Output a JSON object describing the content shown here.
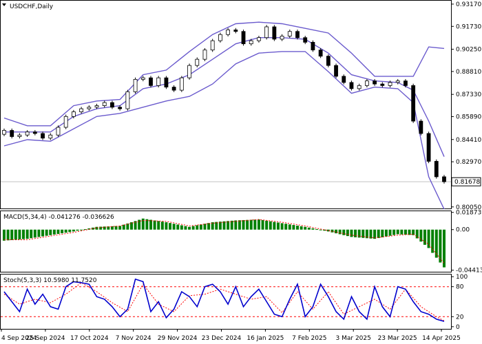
{
  "chart_data": {
    "type": "candlestick",
    "instrument": "USDCHF",
    "timeframe": "Daily",
    "title": "USDCHF,Daily",
    "current_price": "0.81678",
    "price_ticks": [
      "0.93170",
      "0.91730",
      "0.90250",
      "0.88810",
      "0.87330",
      "0.85890",
      "0.84410",
      "0.82970",
      "0.80050"
    ],
    "price_range": [
      0.7995,
      0.9339
    ],
    "date_labels": [
      "4 Sep 2024",
      "25 Sep 2024",
      "17 Oct 2024",
      "7 Nov 2024",
      "29 Nov 2024",
      "23 Dec 2024",
      "16 Jan 2025",
      "7 Feb 2025",
      "3 Mar 2025",
      "23 Mar 2025",
      "14 Apr 2025"
    ],
    "price_series": {
      "candles": [
        {
          "t": 0,
          "o": 0.8475,
          "c": 0.85
        },
        {
          "t": 2,
          "o": 0.85,
          "c": 0.846
        },
        {
          "t": 4,
          "o": 0.846,
          "c": 0.847
        },
        {
          "t": 6,
          "o": 0.847,
          "c": 0.849
        },
        {
          "t": 8,
          "o": 0.849,
          "c": 0.848
        },
        {
          "t": 10,
          "o": 0.848,
          "c": 0.845
        },
        {
          "t": 12,
          "o": 0.845,
          "c": 0.847
        },
        {
          "t": 14,
          "o": 0.847,
          "c": 0.852
        },
        {
          "t": 16,
          "o": 0.852,
          "c": 0.859
        },
        {
          "t": 18,
          "o": 0.859,
          "c": 0.862
        },
        {
          "t": 20,
          "o": 0.862,
          "c": 0.864
        },
        {
          "t": 22,
          "o": 0.864,
          "c": 0.865
        },
        {
          "t": 24,
          "o": 0.865,
          "c": 0.866
        },
        {
          "t": 26,
          "o": 0.866,
          "c": 0.868
        },
        {
          "t": 28,
          "o": 0.868,
          "c": 0.865
        },
        {
          "t": 30,
          "o": 0.865,
          "c": 0.864
        },
        {
          "t": 32,
          "o": 0.864,
          "c": 0.875
        },
        {
          "t": 34,
          "o": 0.875,
          "c": 0.883
        },
        {
          "t": 36,
          "o": 0.883,
          "c": 0.884
        },
        {
          "t": 38,
          "o": 0.884,
          "c": 0.879
        },
        {
          "t": 40,
          "o": 0.879,
          "c": 0.884
        },
        {
          "t": 42,
          "o": 0.884,
          "c": 0.878
        },
        {
          "t": 44,
          "o": 0.878,
          "c": 0.876
        },
        {
          "t": 46,
          "o": 0.876,
          "c": 0.884
        },
        {
          "t": 48,
          "o": 0.884,
          "c": 0.892
        },
        {
          "t": 50,
          "o": 0.892,
          "c": 0.896
        },
        {
          "t": 52,
          "o": 0.896,
          "c": 0.902
        },
        {
          "t": 54,
          "o": 0.902,
          "c": 0.908
        },
        {
          "t": 56,
          "o": 0.908,
          "c": 0.912
        },
        {
          "t": 58,
          "o": 0.912,
          "c": 0.915
        },
        {
          "t": 60,
          "o": 0.915,
          "c": 0.914
        },
        {
          "t": 62,
          "o": 0.914,
          "c": 0.906
        },
        {
          "t": 64,
          "o": 0.906,
          "c": 0.908
        },
        {
          "t": 66,
          "o": 0.908,
          "c": 0.91
        },
        {
          "t": 68,
          "o": 0.91,
          "c": 0.917
        },
        {
          "t": 70,
          "o": 0.917,
          "c": 0.909
        },
        {
          "t": 72,
          "o": 0.909,
          "c": 0.911
        },
        {
          "t": 74,
          "o": 0.911,
          "c": 0.914
        },
        {
          "t": 76,
          "o": 0.914,
          "c": 0.91
        },
        {
          "t": 78,
          "o": 0.91,
          "c": 0.907
        },
        {
          "t": 80,
          "o": 0.907,
          "c": 0.902
        },
        {
          "t": 82,
          "o": 0.902,
          "c": 0.898
        },
        {
          "t": 84,
          "o": 0.898,
          "c": 0.892
        },
        {
          "t": 86,
          "o": 0.892,
          "c": 0.885
        },
        {
          "t": 88,
          "o": 0.885,
          "c": 0.881
        },
        {
          "t": 90,
          "o": 0.881,
          "c": 0.877
        },
        {
          "t": 92,
          "o": 0.877,
          "c": 0.879
        },
        {
          "t": 94,
          "o": 0.879,
          "c": 0.882
        },
        {
          "t": 96,
          "o": 0.882,
          "c": 0.88
        },
        {
          "t": 98,
          "o": 0.88,
          "c": 0.879
        },
        {
          "t": 100,
          "o": 0.879,
          "c": 0.881
        },
        {
          "t": 102,
          "o": 0.881,
          "c": 0.882
        },
        {
          "t": 104,
          "o": 0.882,
          "c": 0.879
        },
        {
          "t": 106,
          "o": 0.879,
          "c": 0.856
        },
        {
          "t": 108,
          "o": 0.856,
          "c": 0.848
        },
        {
          "t": 110,
          "o": 0.848,
          "c": 0.83
        },
        {
          "t": 112,
          "o": 0.83,
          "c": 0.82
        },
        {
          "t": 114,
          "o": 0.82,
          "c": 0.8168
        }
      ],
      "bollinger_upper": [
        {
          "t": 0,
          "v": 0.858
        },
        {
          "t": 6,
          "v": 0.853
        },
        {
          "t": 12,
          "v": 0.853
        },
        {
          "t": 18,
          "v": 0.866
        },
        {
          "t": 24,
          "v": 0.869
        },
        {
          "t": 30,
          "v": 0.87
        },
        {
          "t": 36,
          "v": 0.886
        },
        {
          "t": 42,
          "v": 0.889
        },
        {
          "t": 48,
          "v": 0.901
        },
        {
          "t": 54,
          "v": 0.912
        },
        {
          "t": 60,
          "v": 0.919
        },
        {
          "t": 66,
          "v": 0.92
        },
        {
          "t": 72,
          "v": 0.919
        },
        {
          "t": 78,
          "v": 0.916
        },
        {
          "t": 84,
          "v": 0.913
        },
        {
          "t": 90,
          "v": 0.9
        },
        {
          "t": 96,
          "v": 0.885
        },
        {
          "t": 102,
          "v": 0.885
        },
        {
          "t": 106,
          "v": 0.885
        },
        {
          "t": 110,
          "v": 0.904
        },
        {
          "t": 114,
          "v": 0.903
        }
      ],
      "bollinger_middle": [
        {
          "t": 0,
          "v": 0.849
        },
        {
          "t": 6,
          "v": 0.849
        },
        {
          "t": 12,
          "v": 0.849
        },
        {
          "t": 18,
          "v": 0.859
        },
        {
          "t": 24,
          "v": 0.864
        },
        {
          "t": 30,
          "v": 0.866
        },
        {
          "t": 36,
          "v": 0.877
        },
        {
          "t": 42,
          "v": 0.88
        },
        {
          "t": 48,
          "v": 0.886
        },
        {
          "t": 54,
          "v": 0.896
        },
        {
          "t": 60,
          "v": 0.906
        },
        {
          "t": 66,
          "v": 0.91
        },
        {
          "t": 72,
          "v": 0.91
        },
        {
          "t": 78,
          "v": 0.909
        },
        {
          "t": 84,
          "v": 0.9
        },
        {
          "t": 90,
          "v": 0.886
        },
        {
          "t": 96,
          "v": 0.882
        },
        {
          "t": 102,
          "v": 0.881
        },
        {
          "t": 106,
          "v": 0.876
        },
        {
          "t": 110,
          "v": 0.856
        },
        {
          "t": 114,
          "v": 0.833
        }
      ],
      "bollinger_lower": [
        {
          "t": 0,
          "v": 0.84
        },
        {
          "t": 6,
          "v": 0.844
        },
        {
          "t": 12,
          "v": 0.843
        },
        {
          "t": 18,
          "v": 0.851
        },
        {
          "t": 24,
          "v": 0.859
        },
        {
          "t": 30,
          "v": 0.861
        },
        {
          "t": 36,
          "v": 0.865
        },
        {
          "t": 42,
          "v": 0.869
        },
        {
          "t": 48,
          "v": 0.872
        },
        {
          "t": 54,
          "v": 0.88
        },
        {
          "t": 60,
          "v": 0.893
        },
        {
          "t": 66,
          "v": 0.9
        },
        {
          "t": 72,
          "v": 0.901
        },
        {
          "t": 78,
          "v": 0.901
        },
        {
          "t": 84,
          "v": 0.888
        },
        {
          "t": 90,
          "v": 0.874
        },
        {
          "t": 96,
          "v": 0.878
        },
        {
          "t": 102,
          "v": 0.877
        },
        {
          "t": 106,
          "v": 0.868
        },
        {
          "t": 110,
          "v": 0.82
        },
        {
          "t": 114,
          "v": 0.799
        }
      ]
    },
    "macd": {
      "label": "MACD(5,34,4) -0.041276 -0.036626",
      "ticks": [
        "0.018739",
        "0.00",
        "-0.044134"
      ],
      "range": [
        -0.0458,
        0.02
      ],
      "histogram_points": [
        {
          "t": 0,
          "v": -0.012
        },
        {
          "t": 6,
          "v": -0.01
        },
        {
          "t": 12,
          "v": -0.006
        },
        {
          "t": 18,
          "v": -0.002
        },
        {
          "t": 24,
          "v": 0.003
        },
        {
          "t": 30,
          "v": 0.004
        },
        {
          "t": 36,
          "v": 0.012
        },
        {
          "t": 42,
          "v": 0.008
        },
        {
          "t": 48,
          "v": 0.003
        },
        {
          "t": 54,
          "v": 0.008
        },
        {
          "t": 60,
          "v": 0.01
        },
        {
          "t": 66,
          "v": 0.011
        },
        {
          "t": 72,
          "v": 0.007
        },
        {
          "t": 78,
          "v": 0.003
        },
        {
          "t": 84,
          "v": -0.002
        },
        {
          "t": 90,
          "v": -0.008
        },
        {
          "t": 96,
          "v": -0.01
        },
        {
          "t": 102,
          "v": -0.005
        },
        {
          "t": 106,
          "v": -0.006
        },
        {
          "t": 110,
          "v": -0.02
        },
        {
          "t": 114,
          "v": -0.041
        }
      ],
      "signal_points": [
        {
          "t": 0,
          "v": -0.011
        },
        {
          "t": 6,
          "v": -0.011
        },
        {
          "t": 12,
          "v": -0.007
        },
        {
          "t": 18,
          "v": -0.003
        },
        {
          "t": 24,
          "v": 0.002
        },
        {
          "t": 30,
          "v": 0.004
        },
        {
          "t": 36,
          "v": 0.01
        },
        {
          "t": 42,
          "v": 0.009
        },
        {
          "t": 48,
          "v": 0.004
        },
        {
          "t": 54,
          "v": 0.007
        },
        {
          "t": 60,
          "v": 0.009
        },
        {
          "t": 66,
          "v": 0.011
        },
        {
          "t": 72,
          "v": 0.008
        },
        {
          "t": 78,
          "v": 0.004
        },
        {
          "t": 84,
          "v": -0.001
        },
        {
          "t": 90,
          "v": -0.006
        },
        {
          "t": 96,
          "v": -0.009
        },
        {
          "t": 102,
          "v": -0.006
        },
        {
          "t": 106,
          "v": -0.005
        },
        {
          "t": 110,
          "v": -0.016
        },
        {
          "t": 114,
          "v": -0.0366
        }
      ]
    },
    "stochastic": {
      "label": "Stoch(5,3,3) 10.5980 11.7520",
      "ticks": [
        "100",
        "80",
        "20",
        "0"
      ],
      "levels": [
        80,
        20
      ],
      "main_points": [
        {
          "t": 0,
          "v": 70
        },
        {
          "t": 2,
          "v": 50
        },
        {
          "t": 4,
          "v": 30
        },
        {
          "t": 6,
          "v": 75
        },
        {
          "t": 8,
          "v": 45
        },
        {
          "t": 10,
          "v": 65
        },
        {
          "t": 12,
          "v": 40
        },
        {
          "t": 14,
          "v": 35
        },
        {
          "t": 16,
          "v": 80
        },
        {
          "t": 18,
          "v": 90
        },
        {
          "t": 20,
          "v": 88
        },
        {
          "t": 22,
          "v": 85
        },
        {
          "t": 24,
          "v": 60
        },
        {
          "t": 26,
          "v": 55
        },
        {
          "t": 28,
          "v": 40
        },
        {
          "t": 30,
          "v": 20
        },
        {
          "t": 32,
          "v": 35
        },
        {
          "t": 34,
          "v": 95
        },
        {
          "t": 36,
          "v": 90
        },
        {
          "t": 38,
          "v": 30
        },
        {
          "t": 40,
          "v": 50
        },
        {
          "t": 42,
          "v": 18
        },
        {
          "t": 44,
          "v": 35
        },
        {
          "t": 46,
          "v": 70
        },
        {
          "t": 48,
          "v": 60
        },
        {
          "t": 50,
          "v": 40
        },
        {
          "t": 52,
          "v": 80
        },
        {
          "t": 54,
          "v": 85
        },
        {
          "t": 56,
          "v": 70
        },
        {
          "t": 58,
          "v": 45
        },
        {
          "t": 60,
          "v": 80
        },
        {
          "t": 62,
          "v": 40
        },
        {
          "t": 64,
          "v": 60
        },
        {
          "t": 66,
          "v": 75
        },
        {
          "t": 68,
          "v": 50
        },
        {
          "t": 70,
          "v": 25
        },
        {
          "t": 72,
          "v": 20
        },
        {
          "t": 74,
          "v": 55
        },
        {
          "t": 76,
          "v": 85
        },
        {
          "t": 78,
          "v": 20
        },
        {
          "t": 80,
          "v": 40
        },
        {
          "t": 82,
          "v": 85
        },
        {
          "t": 84,
          "v": 60
        },
        {
          "t": 86,
          "v": 30
        },
        {
          "t": 88,
          "v": 15
        },
        {
          "t": 90,
          "v": 60
        },
        {
          "t": 92,
          "v": 30
        },
        {
          "t": 94,
          "v": 15
        },
        {
          "t": 96,
          "v": 80
        },
        {
          "t": 98,
          "v": 40
        },
        {
          "t": 100,
          "v": 20
        },
        {
          "t": 102,
          "v": 80
        },
        {
          "t": 104,
          "v": 75
        },
        {
          "t": 106,
          "v": 50
        },
        {
          "t": 108,
          "v": 30
        },
        {
          "t": 110,
          "v": 25
        },
        {
          "t": 112,
          "v": 15
        },
        {
          "t": 114,
          "v": 10.6
        }
      ],
      "signal_points": [
        {
          "t": 0,
          "v": 65
        },
        {
          "t": 4,
          "v": 45
        },
        {
          "t": 8,
          "v": 55
        },
        {
          "t": 12,
          "v": 48
        },
        {
          "t": 16,
          "v": 65
        },
        {
          "t": 20,
          "v": 88
        },
        {
          "t": 24,
          "v": 70
        },
        {
          "t": 28,
          "v": 48
        },
        {
          "t": 32,
          "v": 30
        },
        {
          "t": 36,
          "v": 85
        },
        {
          "t": 40,
          "v": 45
        },
        {
          "t": 44,
          "v": 30
        },
        {
          "t": 48,
          "v": 62
        },
        {
          "t": 52,
          "v": 65
        },
        {
          "t": 56,
          "v": 75
        },
        {
          "t": 60,
          "v": 65
        },
        {
          "t": 64,
          "v": 55
        },
        {
          "t": 68,
          "v": 60
        },
        {
          "t": 72,
          "v": 28
        },
        {
          "t": 76,
          "v": 70
        },
        {
          "t": 80,
          "v": 35
        },
        {
          "t": 84,
          "v": 70
        },
        {
          "t": 88,
          "v": 25
        },
        {
          "t": 92,
          "v": 40
        },
        {
          "t": 96,
          "v": 55
        },
        {
          "t": 100,
          "v": 35
        },
        {
          "t": 104,
          "v": 75
        },
        {
          "t": 108,
          "v": 40
        },
        {
          "t": 112,
          "v": 20
        },
        {
          "t": 114,
          "v": 11.8
        }
      ]
    },
    "colors": {
      "bull_candle": "#ffffff",
      "bear_candle": "#000000",
      "bollinger": "#6a5acd",
      "macd_hist": "#008000",
      "macd_signal": "#ff0000",
      "stoch_main": "#0000cd",
      "stoch_signal": "#ff0000",
      "level_line": "#ff0000",
      "current_price_line": "#c0c0c0"
    }
  }
}
